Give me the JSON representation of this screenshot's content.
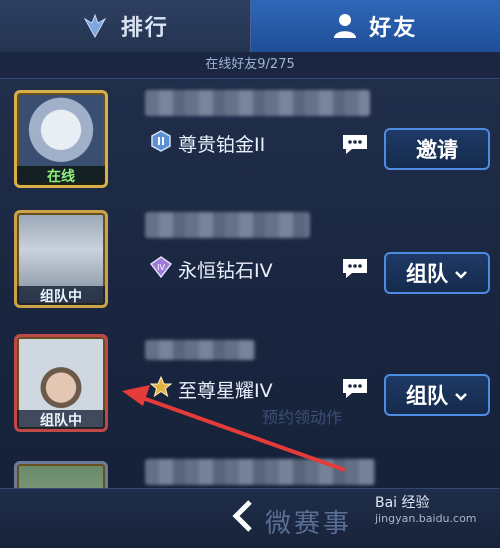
{
  "tabs": [
    {
      "label": "排行",
      "icon": "ranking-wing-icon",
      "active": false
    },
    {
      "label": "好友",
      "icon": "person-icon",
      "active": true
    }
  ],
  "online_count": "在线好友9/275",
  "friends": [
    {
      "status": "在线",
      "rank": "尊贵铂金II",
      "rank_icon": "platinum-badge-icon",
      "action": "邀请",
      "has_dropdown": false
    },
    {
      "status": "组队中",
      "rank": "永恒钻石IV",
      "rank_icon": "diamond-badge-icon",
      "action": "组队",
      "has_dropdown": true
    },
    {
      "status": "组队中",
      "rank": "至尊星耀IV",
      "rank_icon": "starlight-badge-icon",
      "action": "组队",
      "has_dropdown": true
    }
  ],
  "background_text": "预约领动作",
  "footer": {
    "text": "微赛事"
  },
  "watermark": {
    "brand": "Bai 经验",
    "url": "jingyan.baidu.com"
  },
  "colors": {
    "active_tab": "#2f67b8",
    "online_status": "#8ff07a",
    "button_border": "#4d8ce0",
    "arrow": "#e53b3b"
  }
}
